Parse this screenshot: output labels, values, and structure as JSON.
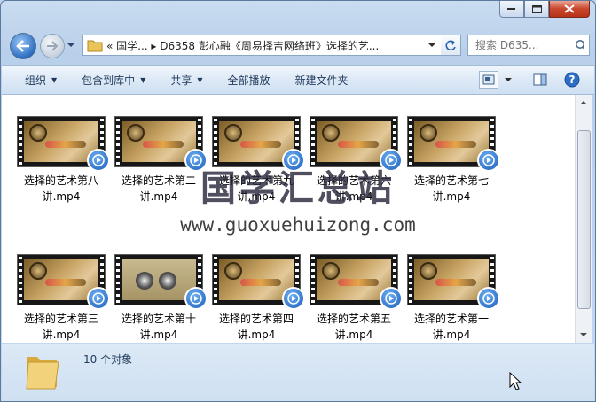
{
  "window": {
    "caption_buttons": [
      "minimize-icon",
      "maximize-icon",
      "close-icon"
    ]
  },
  "nav": {
    "address_breadcrumb": "«  国学...  ▸  D6358 彭心融《周易择吉网络班》选择的艺...",
    "search_placeholder": "搜索 D635..."
  },
  "toolbar": {
    "organize": "组织",
    "include_library": "包含到库中",
    "share": "共享",
    "play_all": "全部播放",
    "new_folder": "新建文件夹"
  },
  "files": [
    {
      "name": "选择的艺术第八讲.mp4",
      "style": "scroll"
    },
    {
      "name": "选择的艺术第二讲.mp4",
      "style": "scroll"
    },
    {
      "name": "选择的艺术第九讲.mp4",
      "style": "scroll"
    },
    {
      "name": "选择的艺术第六讲.mp4",
      "style": "scroll"
    },
    {
      "name": "选择的艺术第七讲.mp4",
      "style": "scroll"
    },
    {
      "name": "选择的艺术第三讲.mp4",
      "style": "scroll"
    },
    {
      "name": "选择的艺术第十讲.mp4",
      "style": "coins"
    },
    {
      "name": "选择的艺术第四讲.mp4",
      "style": "scroll"
    },
    {
      "name": "选择的艺术第五讲.mp4",
      "style": "scroll"
    },
    {
      "name": "选择的艺术第一讲.mp4",
      "style": "scroll"
    }
  ],
  "details": {
    "count": "10 个对象"
  },
  "watermark": {
    "title": "国学汇总站",
    "url": "www.guoxuehuizong.com"
  },
  "colors": {
    "window_frame": "#b9d0ea",
    "toolbar_text": "#1e395b",
    "close_button": "#c9462c"
  }
}
